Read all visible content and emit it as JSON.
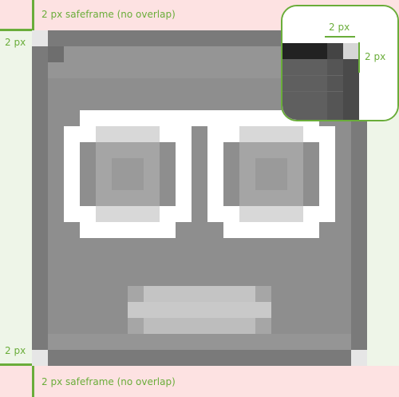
{
  "labels": {
    "safeframe_top": "2 px safeframe (no overlap)",
    "safeframe_bottom": "2 px safeframe (no overlap)",
    "left_top": "2 px",
    "left_bottom": "2 px",
    "zoom_horizontal": "2 px",
    "zoom_vertical": "2 px"
  },
  "colors": {
    "safeframe_band": "#fde2e2",
    "side_band": "#eef5e8",
    "guide": "#6aad3a",
    "frame_gray": "#7a7a7a",
    "inner_gray": "#8e8e8e",
    "eye_white": "#ffffff",
    "lens_gray": "#a5a5a5",
    "mouth_gray": "#c4c4c4"
  },
  "icon": "robot-face-with-glasses-icon"
}
